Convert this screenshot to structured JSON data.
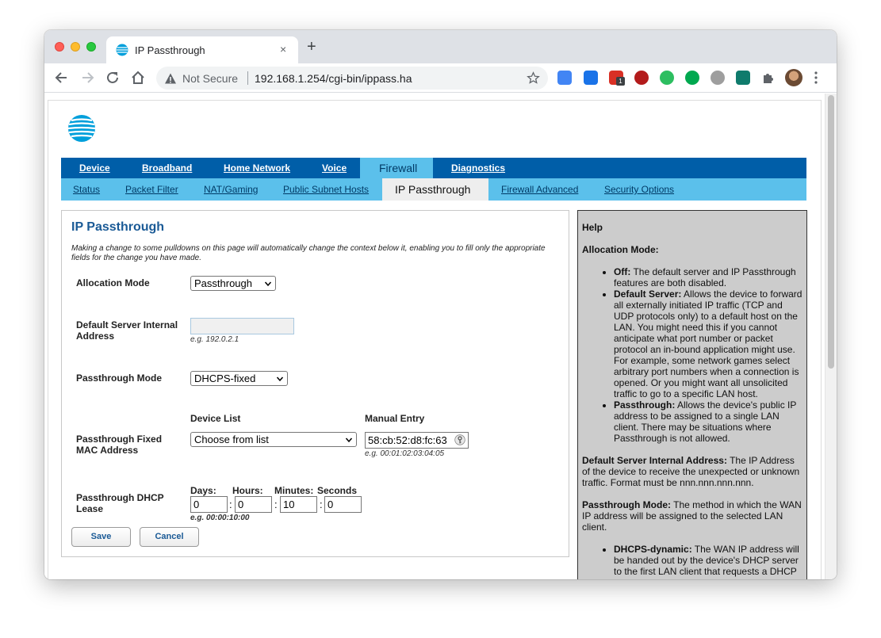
{
  "browser": {
    "tab_title": "IP Passthrough",
    "close_glyph": "×",
    "new_tab_glyph": "+",
    "security_label": "Not Secure",
    "url": "192.168.1.254/cgi-bin/ippass.ha",
    "extension_badge": "1"
  },
  "nav": {
    "primary": [
      "Device",
      "Broadband",
      "Home Network",
      "Voice",
      "Firewall",
      "Diagnostics"
    ],
    "active_primary": "Firewall",
    "secondary": [
      "Status",
      "Packet Filter",
      "NAT/Gaming",
      "Public Subnet Hosts",
      "IP Passthrough",
      "Firewall Advanced",
      "Security Options"
    ],
    "active_secondary": "IP Passthrough"
  },
  "form": {
    "heading": "IP Passthrough",
    "intro": "Making a change to some pulldowns on this page will automatically change the context below it, enabling you to fill only the appropriate fields for the change you have made.",
    "allocation_mode": {
      "label": "Allocation Mode",
      "value": "Passthrough"
    },
    "default_server": {
      "label_1": "Default Server Internal",
      "label_2": "Address",
      "value": "",
      "hint": "e.g. 192.0.2.1"
    },
    "passthrough_mode": {
      "label": "Passthrough Mode",
      "value": "DHCPS-fixed"
    },
    "fixed_mac": {
      "label_1": "Passthrough Fixed",
      "label_2": "MAC Address",
      "device_list_header": "Device List",
      "device_list_value": "Choose from list",
      "manual_header": "Manual Entry",
      "manual_value": "58:cb:52:d8:fc:63",
      "hint": "e.g. 00:01:02:03:04:05"
    },
    "dhcp_lease": {
      "label_1": "Passthrough DHCP",
      "label_2": "Lease",
      "days_label": "Days:",
      "hours_label": "Hours:",
      "minutes_label": "Minutes:",
      "seconds_label": "Seconds",
      "days": "0",
      "hours": "0",
      "minutes": "10",
      "seconds": "0",
      "separator": ":",
      "hint": "e.g. 00:00:10:00"
    },
    "save_label": "Save",
    "cancel_label": "Cancel"
  },
  "help": {
    "title": "Help",
    "alloc_heading": "Allocation Mode:",
    "alloc_items": [
      {
        "term": "Off:",
        "text": " The default server and IP Passthrough features are both disabled."
      },
      {
        "term": "Default Server:",
        "text": " Allows the device to forward all externally initiated IP traffic (TCP and UDP protocols only) to a default host on the LAN. You might need this if you cannot anticipate what port number or packet protocol an in-bound application might use. For example, some network games select arbitrary port numbers when a connection is opened. Or you might want all unsolicited traffic to go to a specific LAN host."
      },
      {
        "term": "Passthrough:",
        "text": " Allows the device's public IP address to be assigned to a single LAN client. There may be situations where Passthrough is not allowed."
      }
    ],
    "default_server_term": "Default Server Internal Address:",
    "default_server_text": " The IP Address of the device to receive the unexpected or unknown traffic. Format must be nnn.nnn.nnn.nnn.",
    "pt_mode_term": "Passthrough Mode:",
    "pt_mode_text": " The method in which the WAN IP address will be assigned to the selected LAN client.",
    "pt_items": [
      {
        "term": "DHCPS-dynamic:",
        "text": " The WAN IP address will be handed out by the device's DHCP server to the first LAN client that requests a DHCP"
      }
    ]
  },
  "colors": {
    "nav_primary": "#005ea8",
    "nav_secondary": "#5bc0eb",
    "heading": "#1a5a96",
    "help_bg": "#cccccc"
  },
  "icons": [
    "browser-favicon-att",
    "back-arrow-icon",
    "forward-arrow-icon",
    "reload-icon",
    "home-icon",
    "warning-icon",
    "star-icon",
    "extensions-puzzle-icon",
    "kebab-menu-icon",
    "att-globe-icon",
    "chevron-down-icon",
    "key-icon"
  ]
}
